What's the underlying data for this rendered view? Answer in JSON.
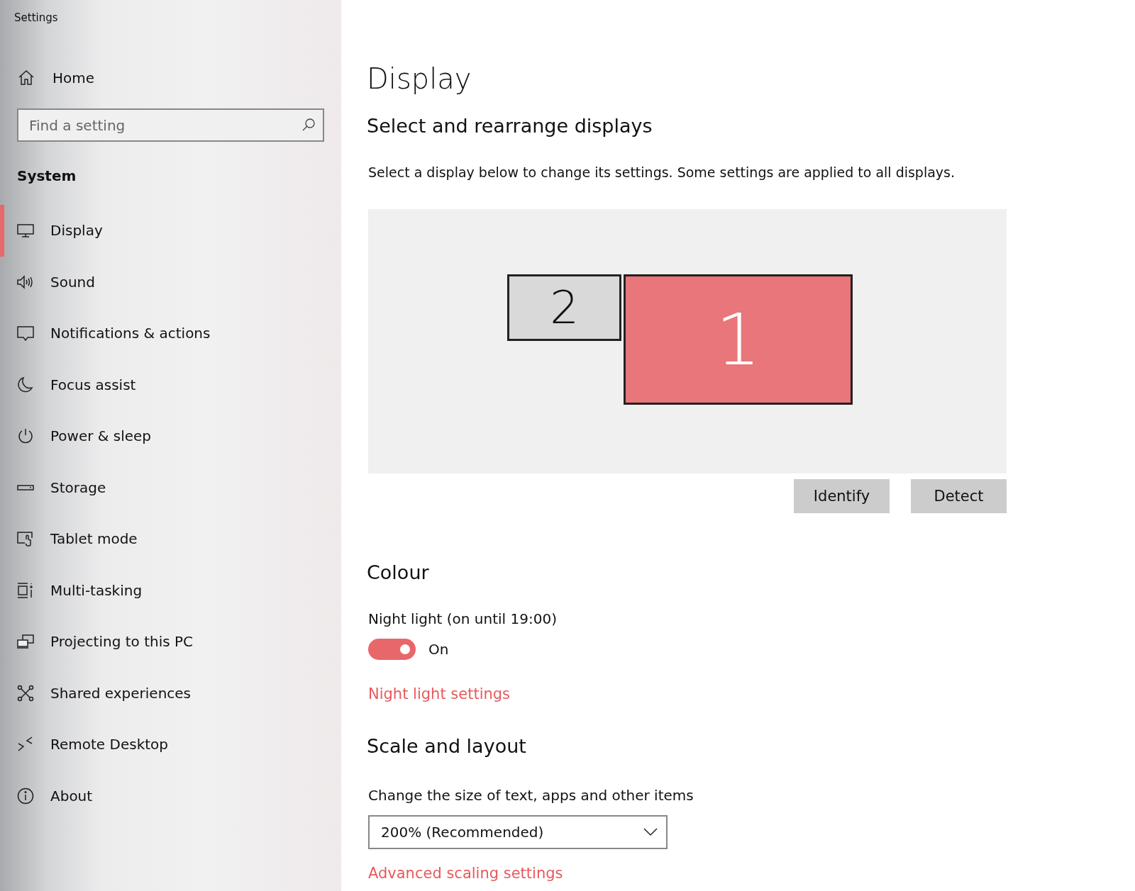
{
  "window": {
    "title": "Settings"
  },
  "sidebar": {
    "home": {
      "label": "Home"
    },
    "search": {
      "placeholder": "Find a setting"
    },
    "section": "System",
    "items": [
      {
        "label": "Display",
        "selected": true
      },
      {
        "label": "Sound",
        "selected": false
      },
      {
        "label": "Notifications & actions",
        "selected": false
      },
      {
        "label": "Focus assist",
        "selected": false
      },
      {
        "label": "Power & sleep",
        "selected": false
      },
      {
        "label": "Storage",
        "selected": false
      },
      {
        "label": "Tablet mode",
        "selected": false
      },
      {
        "label": "Multi-tasking",
        "selected": false
      },
      {
        "label": "Projecting to this PC",
        "selected": false
      },
      {
        "label": "Shared experiences",
        "selected": false
      },
      {
        "label": "Remote Desktop",
        "selected": false
      },
      {
        "label": "About",
        "selected": false
      }
    ]
  },
  "main": {
    "title": "Display",
    "arrange": {
      "heading": "Select and rearrange displays",
      "description": "Select a display below to change its settings. Some settings are applied to all displays.",
      "monitors": [
        {
          "label": "2",
          "selected": false
        },
        {
          "label": "1",
          "selected": true
        }
      ],
      "buttons": [
        "Identify",
        "Detect"
      ]
    },
    "colour": {
      "heading": "Colour",
      "night_light_label": "Night light (on until 19:00)",
      "toggle": {
        "on": true,
        "label": "On"
      },
      "link": "Night light settings"
    },
    "scale": {
      "heading": "Scale and layout",
      "label": "Change the size of text, apps and other items",
      "dropdown": {
        "value": "200% (Recommended)"
      },
      "link": "Advanced scaling settings"
    }
  }
}
